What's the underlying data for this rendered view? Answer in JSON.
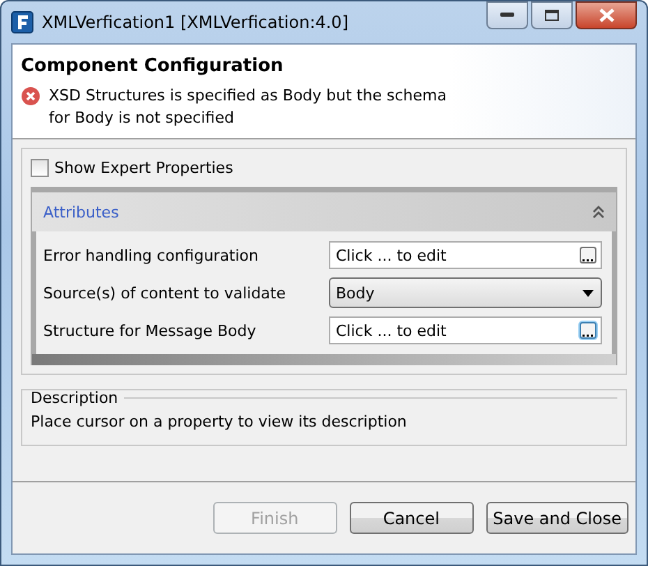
{
  "window": {
    "title": "XMLVerfication1 [XMLVerfication:4.0]"
  },
  "header": {
    "title": "Component Configuration",
    "message": "XSD Structures is specified as Body but the schema for Body is not specified"
  },
  "show_expert": {
    "label": "Show Expert Properties",
    "checked": false
  },
  "attributes": {
    "title": "Attributes",
    "expanded": true,
    "rows": [
      {
        "label": "Error handling configuration",
        "kind": "button-field",
        "value": "Click ... to edit",
        "focused": false
      },
      {
        "label": "Source(s) of content to validate",
        "kind": "dropdown",
        "value": "Body"
      },
      {
        "label": "Structure for Message Body",
        "kind": "button-field",
        "value": "Click ... to edit",
        "focused": true
      }
    ]
  },
  "description": {
    "title": "Description",
    "text": "Place cursor on a property to view its description"
  },
  "buttons": [
    {
      "label": "Finish",
      "disabled": true
    },
    {
      "label": "Cancel",
      "disabled": false
    },
    {
      "label": "Save and Close",
      "disabled": false
    }
  ]
}
